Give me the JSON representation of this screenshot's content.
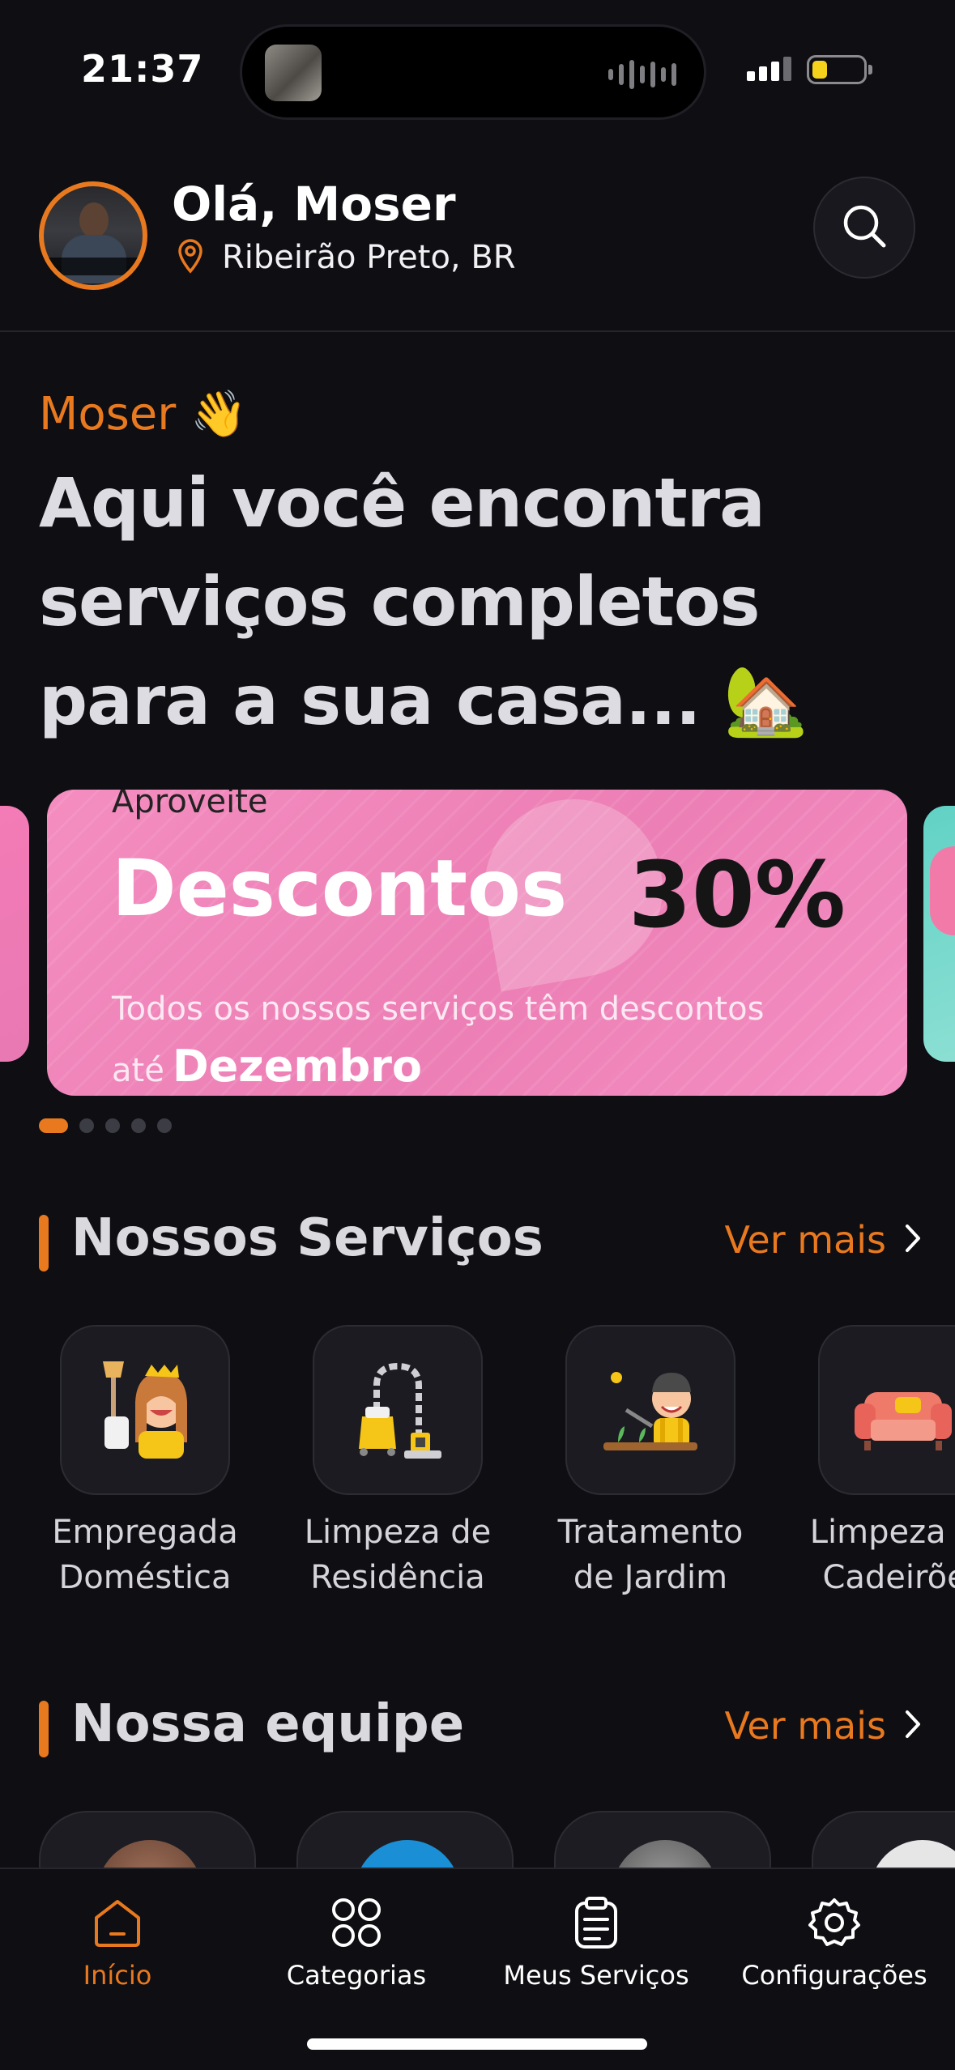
{
  "status_bar": {
    "time": "21:37"
  },
  "header": {
    "greeting": "Olá, Moser",
    "location": "Ribeirão Preto, BR"
  },
  "hero": {
    "name": "Moser 👋",
    "title": "Aqui você encontra serviços completos para a sua casa... 🏡"
  },
  "promo": {
    "kicker": "Aproveite",
    "title": "Descontos",
    "percent": "30%",
    "description": "Todos os nossos serviços têm descontos",
    "until_prefix": "até",
    "until_month": "Dezembro",
    "pages": 5,
    "active_page": 1
  },
  "services_section": {
    "title": "Nossos Serviços",
    "more": "Ver mais",
    "items": [
      {
        "label": "Empregada\nDoméstica",
        "icon": "maid-icon"
      },
      {
        "label": "Limpeza de\nResidência",
        "icon": "vacuum-cleaner-icon"
      },
      {
        "label": "Tratamento\nde Jardim",
        "icon": "gardener-icon"
      },
      {
        "label": "Limpeza de\nCadeirões",
        "icon": "sofa-icon"
      }
    ]
  },
  "team_section": {
    "title": "Nossa equipe",
    "more": "Ver mais"
  },
  "tabs": [
    {
      "label": "Início",
      "icon": "home-icon",
      "active": true
    },
    {
      "label": "Categorias",
      "icon": "categories-icon",
      "active": false
    },
    {
      "label": "Meus Serviços",
      "icon": "clipboard-icon",
      "active": false
    },
    {
      "label": "Configurações",
      "icon": "gear-icon",
      "active": false
    }
  ],
  "colors": {
    "background": "#0e0e13",
    "accent": "#e8791f",
    "promo_pink": "#ec7fb5"
  }
}
